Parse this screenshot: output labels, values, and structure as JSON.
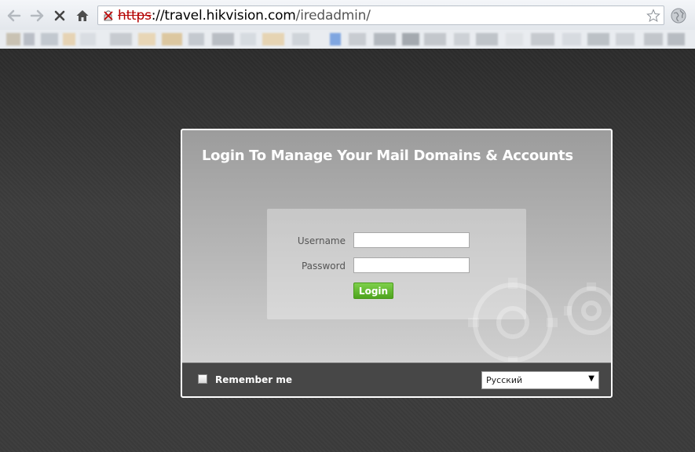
{
  "browser": {
    "url_scheme": "https",
    "url_host": "://travel.hikvision.com",
    "url_path": "/iredadmin/",
    "icons": {
      "back": "back-arrow-icon",
      "forward": "forward-arrow-icon",
      "stop": "stop-icon",
      "home": "home-icon",
      "security": "broken-lock-icon",
      "bookmark": "star-icon",
      "extension": "globe-icon"
    }
  },
  "login": {
    "title": "Login To Manage Your Mail Domains & Accounts",
    "username_label": "Username",
    "username_value": "",
    "password_label": "Password",
    "password_value": "",
    "login_button": "Login",
    "remember_label": "Remember me",
    "remember_checked": false,
    "language_selected": "Русский"
  },
  "colors": {
    "login_button": "#5fb52c",
    "page_background": "#3a3a3a",
    "footer_background": "#474747"
  }
}
